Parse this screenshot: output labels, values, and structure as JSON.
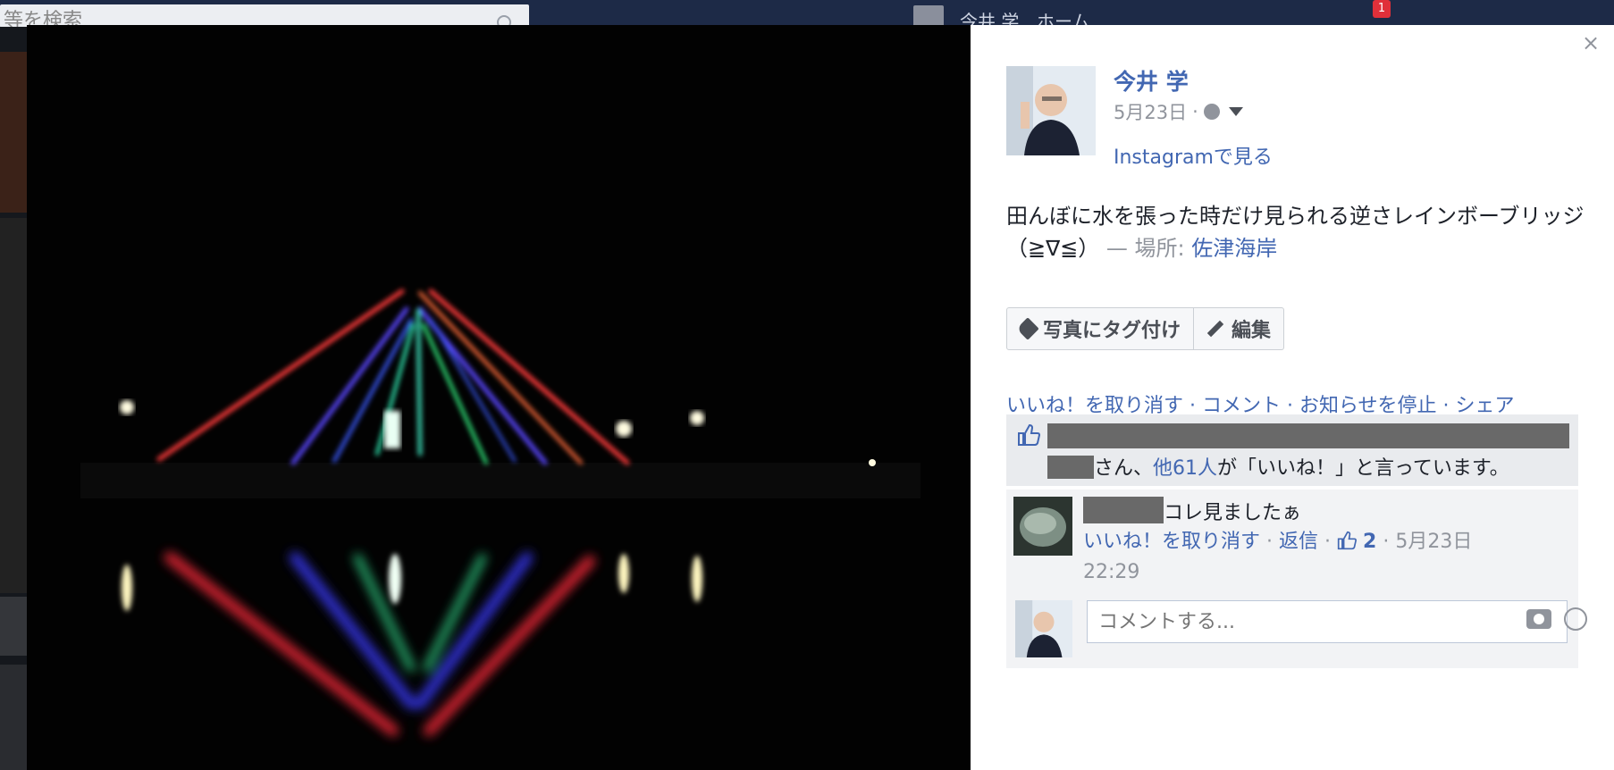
{
  "background": {
    "search_placeholder": "等を検索",
    "user_name": "今井 学",
    "home_label": "ホーム",
    "notification_count": "1"
  },
  "post": {
    "author": "今井 学",
    "date": "5月23日",
    "meta_separator": "·",
    "instagram_link": "Instagramで見る",
    "caption": "田んぼに水を張った時だけ見られる逆さレインボーブリッジ（≧∇≦）",
    "location_prefix": "— 場所:",
    "location": "佐津海岸"
  },
  "buttons": {
    "tag_photo": "写真にタグ付け",
    "edit": "編集"
  },
  "actions": {
    "unlike": "いいね！を取り消す",
    "comment": "コメント",
    "stop_notifications": "お知らせを停止",
    "share": "シェア",
    "separator": " · "
  },
  "likes": {
    "suffix_san": "さん、",
    "others": "他61人",
    "tail": "が「いいね！」と言っています。"
  },
  "comment": {
    "text": "コレ見ましたぁ",
    "unlike": "いいね！を取り消す",
    "reply": "返信",
    "like_count": "2",
    "date": "5月23日",
    "time": "22:29"
  },
  "comment_input": {
    "placeholder": "コメントする..."
  },
  "icons": {
    "close": "close-icon",
    "globe": "globe-icon",
    "tag": "tag-icon",
    "pencil": "pencil-icon",
    "like": "thumbs-up-icon",
    "camera": "camera-icon",
    "emoji": "smiley-icon"
  },
  "colors": {
    "link": "#4267b2",
    "muted": "#90949c",
    "panel_bg": "#ffffff",
    "redaction": "#696969"
  }
}
